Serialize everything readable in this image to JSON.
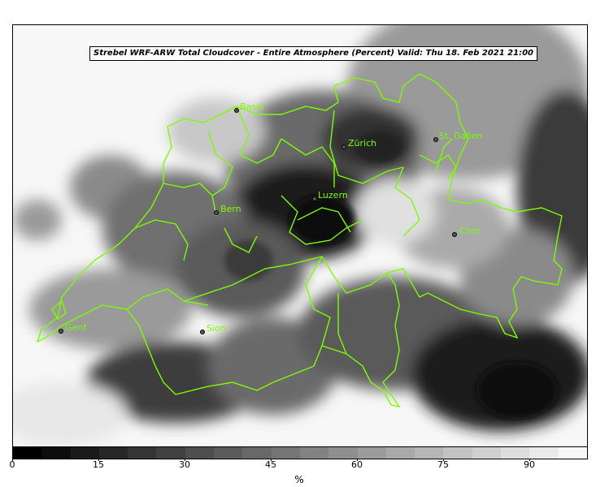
{
  "title": "Strebel WRF-ARW Total Cloudcover - Entire Atmosphere (Percent)   Valid: Thu 18. Feb 2021 21:00",
  "colors": {
    "border": "#7cfc00",
    "frame": "#000000"
  },
  "cities": [
    {
      "id": "basel",
      "name": "Basel"
    },
    {
      "id": "zurich",
      "name": "Zürich"
    },
    {
      "id": "st-gallen",
      "name": "St. Gallen"
    },
    {
      "id": "luzern",
      "name": "Luzern"
    },
    {
      "id": "bern",
      "name": "Bern"
    },
    {
      "id": "chur",
      "name": "Chur"
    },
    {
      "id": "genf",
      "name": "Genf"
    },
    {
      "id": "sion",
      "name": "Sion"
    }
  ],
  "colorbar": {
    "min": 0,
    "max": 100,
    "ticks": [
      "0",
      "15",
      "30",
      "45",
      "60",
      "75",
      "90"
    ],
    "label": "%"
  }
}
